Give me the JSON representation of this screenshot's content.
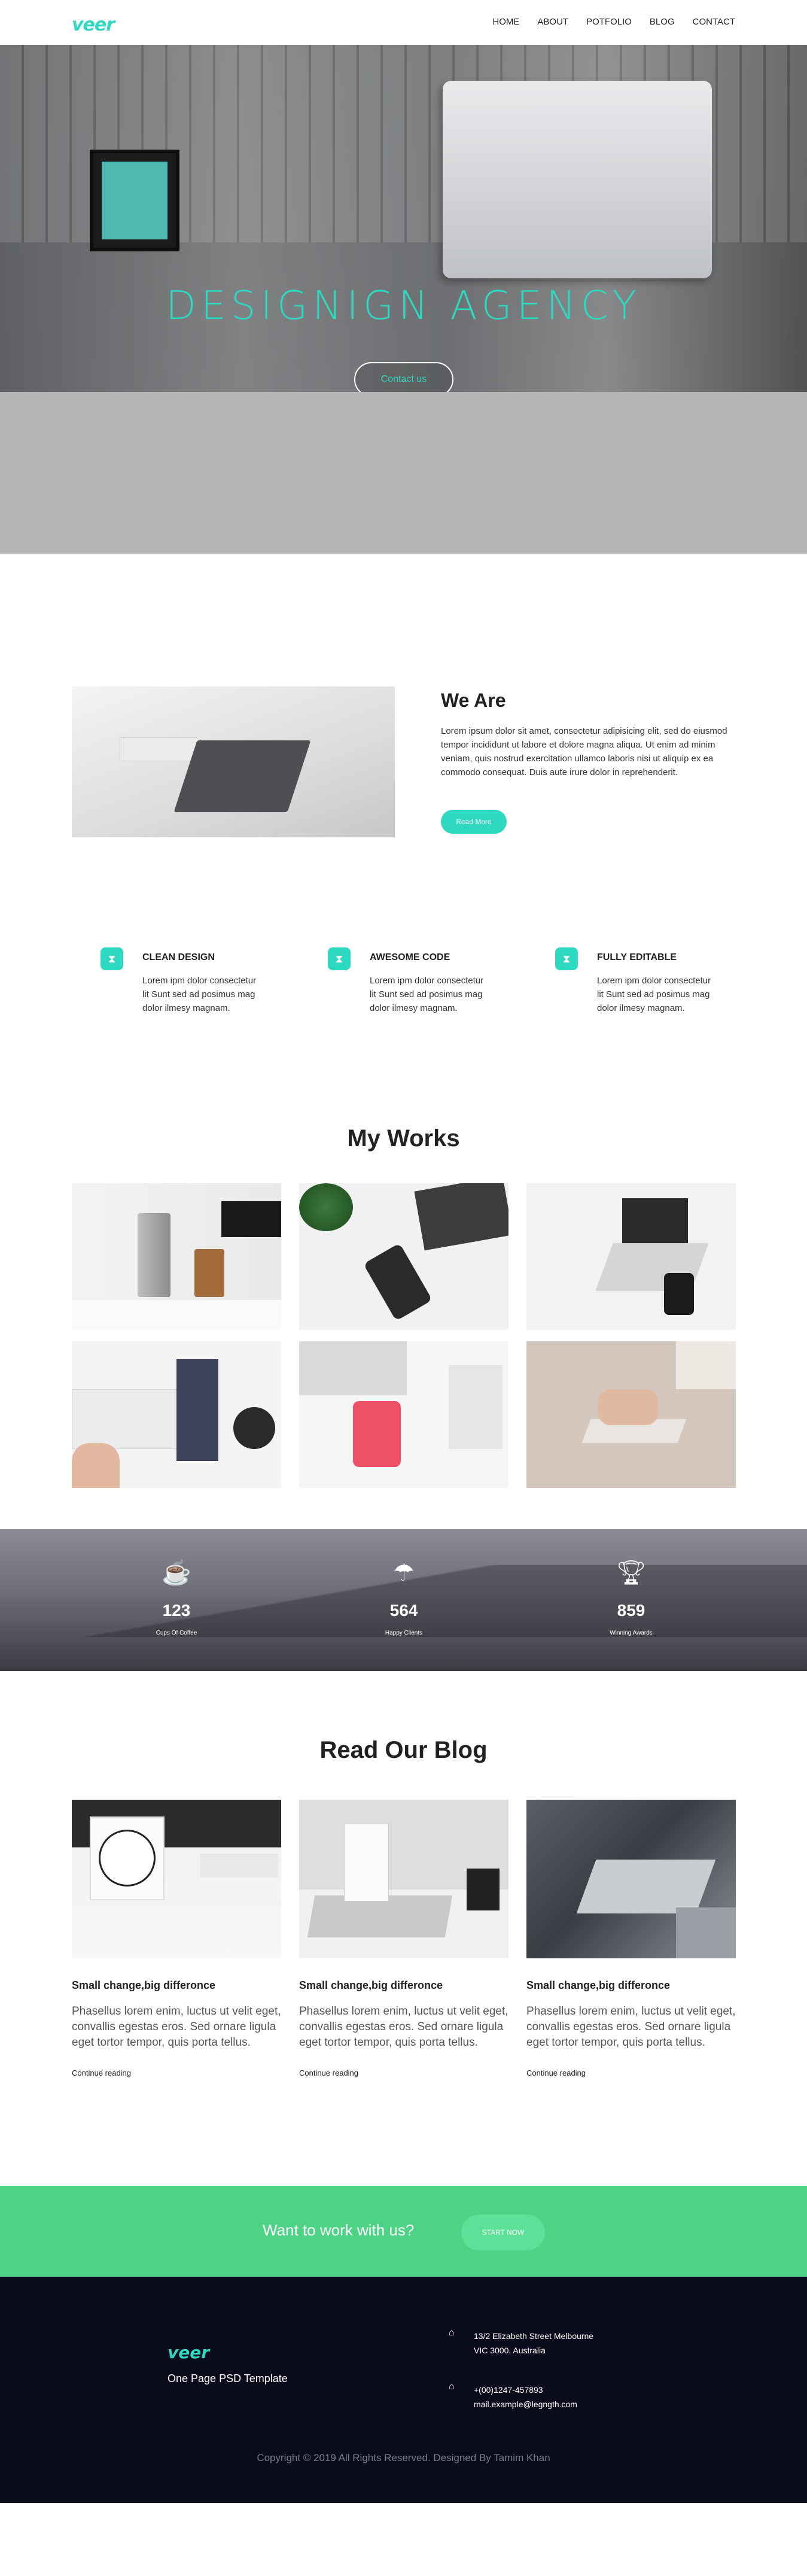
{
  "nav": {
    "logo": "veer",
    "items": [
      "HOME",
      "ABOUT",
      "POTFOLIO",
      "BLOG",
      "CONTACT"
    ]
  },
  "hero": {
    "title": "DESIGNIGN AGENCY",
    "button": "Contact us"
  },
  "about": {
    "title": "We Are",
    "body": "Lorem ipsum dolor sit amet, consectetur adipisicing elit, sed do eiusmod tempor incididunt ut labore et dolore magna aliqua. Ut enim ad minim veniam, quis nostrud exercitation ullamco laboris nisi ut aliquip ex ea commodo consequat. Duis aute irure dolor in reprehenderit.",
    "button": "Read More"
  },
  "features": [
    {
      "title": "CLEAN DESIGN",
      "text": "Lorem ipm dolor consectetur lit Sunt sed ad posimus mag dolor ilmesy magnam.",
      "icon": "hourglass-icon"
    },
    {
      "title": "AWESOME CODE",
      "text": "Lorem ipm dolor consectetur lit Sunt sed ad posimus mag dolor ilmesy magnam.",
      "icon": "hourglass-icon"
    },
    {
      "title": "FULLY EDITABLE",
      "text": "Lorem ipm dolor consectetur lit Sunt sed ad posimus mag dolor ilmesy magnam.",
      "icon": "hourglass-icon"
    }
  ],
  "works": {
    "title": "My Works"
  },
  "stats": [
    {
      "value": "123",
      "label": "Cups Of Coffee",
      "icon": "coffee-cup-icon"
    },
    {
      "value": "564",
      "label": "Happy Clients",
      "icon": "umbrella-icon"
    },
    {
      "value": "859",
      "label": "Winning Awards",
      "icon": "trophy-icon"
    }
  ],
  "blog": {
    "title": "Read Our Blog",
    "posts": [
      {
        "title": "Small change,big differonce",
        "excerpt": "Phasellus lorem enim, luctus ut velit eget, convallis egestas eros. Sed ornare ligula eget tortor tempor, quis porta tellus.",
        "link": "Continue reading"
      },
      {
        "title": "Small change,big differonce",
        "excerpt": "Phasellus lorem enim, luctus ut velit eget, convallis egestas eros. Sed ornare ligula eget tortor tempor, quis porta tellus.",
        "link": "Continue reading"
      },
      {
        "title": "Small change,big differonce",
        "excerpt": "Phasellus lorem enim, luctus ut velit eget, convallis egestas eros. Sed ornare ligula eget tortor tempor, quis porta tellus.",
        "link": "Continue reading"
      }
    ]
  },
  "cta": {
    "text": "Want to work with us?",
    "button": "START NOW"
  },
  "footer": {
    "logo": "veer",
    "tagline": "One Page PSD Template",
    "address_1": "13/2 Elizabeth Street Melbourne",
    "address_2": "VIC 3000, Australia",
    "phone": "+(00)1247-457893",
    "email": "mail.example@legngth.com",
    "copyright": "Copyright © 2019 All Rights Reserved. Designed By Tamim Khan"
  },
  "colors": {
    "accent": "#2fd8c0",
    "cta": "#4cd386",
    "footer": "#0a0c1c"
  }
}
